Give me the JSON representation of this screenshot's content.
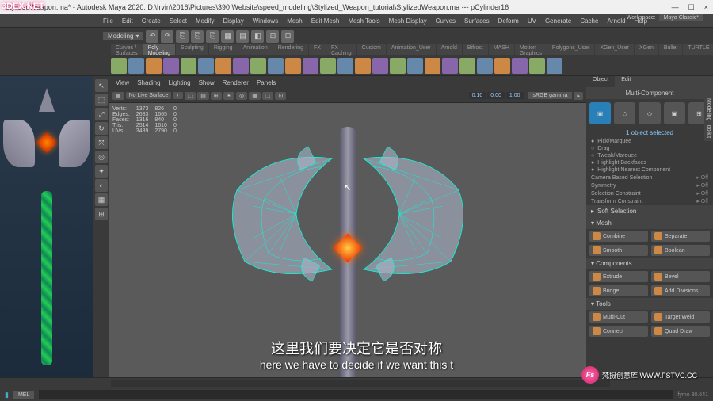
{
  "logo": "3DEX.NET",
  "window": {
    "title": "StylizedWeapon.ma* - Autodesk Maya 2020: D:\\Irvin\\2016\\Pictures\\390 Website\\speed_modeling\\Stylized_Weapon_tutorial\\StylizedWeapon.ma  ---  pCylinder16",
    "min": "—",
    "max": "☐",
    "close": "×"
  },
  "menus": [
    "File",
    "Edit",
    "Create",
    "Select",
    "Modify",
    "Display",
    "Windows",
    "Mesh",
    "Edit Mesh",
    "Mesh Tools",
    "Mesh Display",
    "Curves",
    "Surfaces",
    "Deform",
    "UV",
    "Generate",
    "Cache",
    "Arnold",
    "Help"
  ],
  "workspace": {
    "label": "Workspace:",
    "value": "Maya Classic*"
  },
  "mode_dropdown": "Modeling",
  "status_icons": [
    "↶",
    "↷",
    "⎘",
    "⎘",
    "⎘",
    "▦",
    "▤",
    "◧",
    "⊞",
    "⊡"
  ],
  "shelf": {
    "top_tabs": [
      "Curves / Surfaces",
      "Poly Modeling",
      "Sculpting",
      "Rigging",
      "Animation",
      "Rendering",
      "FX",
      "FX Caching",
      "Custom",
      "Animation_User",
      "Arnold",
      "Bifrost",
      "MASH",
      "Motion Graphics",
      "Polygons_User",
      "XGen_User",
      "XGen",
      "Bullet",
      "TURTLE"
    ],
    "active_tab": "Poly Modeling"
  },
  "viewport_menu": [
    "View",
    "Shading",
    "Lighting",
    "Show",
    "Renderer",
    "Panels"
  ],
  "viewport_bar": {
    "surface": "No Live Surface",
    "nums": [
      "0.10",
      "0.00",
      "1.00"
    ],
    "colorspace": "sRGB gamma"
  },
  "hud": {
    "rows": [
      [
        "Verts:",
        "1373",
        "826",
        "0"
      ],
      [
        "Edges:",
        "2683",
        "1665",
        "0"
      ],
      [
        "Faces:",
        "1316",
        "840",
        "0"
      ],
      [
        "Tris:",
        "2514",
        "1610",
        "0"
      ],
      [
        "UVs:",
        "3439",
        "2790",
        "0"
      ]
    ]
  },
  "toolbox": [
    "↖",
    "⬚",
    "⤢",
    "↻",
    "⤧",
    "◎",
    "✦",
    "◐",
    "▦",
    "⊞"
  ],
  "right": {
    "tabs": [
      "Object",
      "Edit"
    ],
    "multi_comp": "Multi-Component",
    "sel_info": "1 object selected",
    "side_label": "Modeling Toolkit",
    "pick_modes": [
      {
        "label": "Pick/Marquee",
        "checked": true
      },
      {
        "label": "Drag",
        "checked": false
      },
      {
        "label": "Tweak/Marquee",
        "checked": false
      },
      {
        "label": "Highlight Backfaces",
        "checked": true
      },
      {
        "label": "Highlight Nearest Component",
        "checked": true
      }
    ],
    "options": [
      {
        "label": "Camera Based Selection",
        "value": "Off"
      },
      {
        "label": "Symmetry",
        "value": "Off"
      },
      {
        "label": "Selection Constraint",
        "value": "Off"
      },
      {
        "label": "Transform Constraint",
        "value": "Off"
      }
    ],
    "soft_sel": "Soft Selection",
    "sections": [
      {
        "name": "Mesh",
        "tools": [
          [
            "Combine",
            "Separate"
          ],
          [
            "Smooth",
            "Boolean"
          ]
        ]
      },
      {
        "name": "Components",
        "tools": [
          [
            "Extrude",
            "Bevel"
          ],
          [
            "Bridge",
            "Add Divisions"
          ]
        ]
      },
      {
        "name": "Tools",
        "tools": [
          [
            "Multi-Cut",
            "Target Weld"
          ],
          [
            "Connect",
            "Quad Draw"
          ]
        ]
      }
    ]
  },
  "timeline": {
    "mel": "MEL",
    "frame": "30.641"
  },
  "subtitle": {
    "cn": "这里我们要决定它是否对称",
    "en": "here we have to decide if we want this t"
  },
  "watermark": {
    "badge": "Fs",
    "text": "梵摄创意库  WWW.FSTVC.CC"
  }
}
